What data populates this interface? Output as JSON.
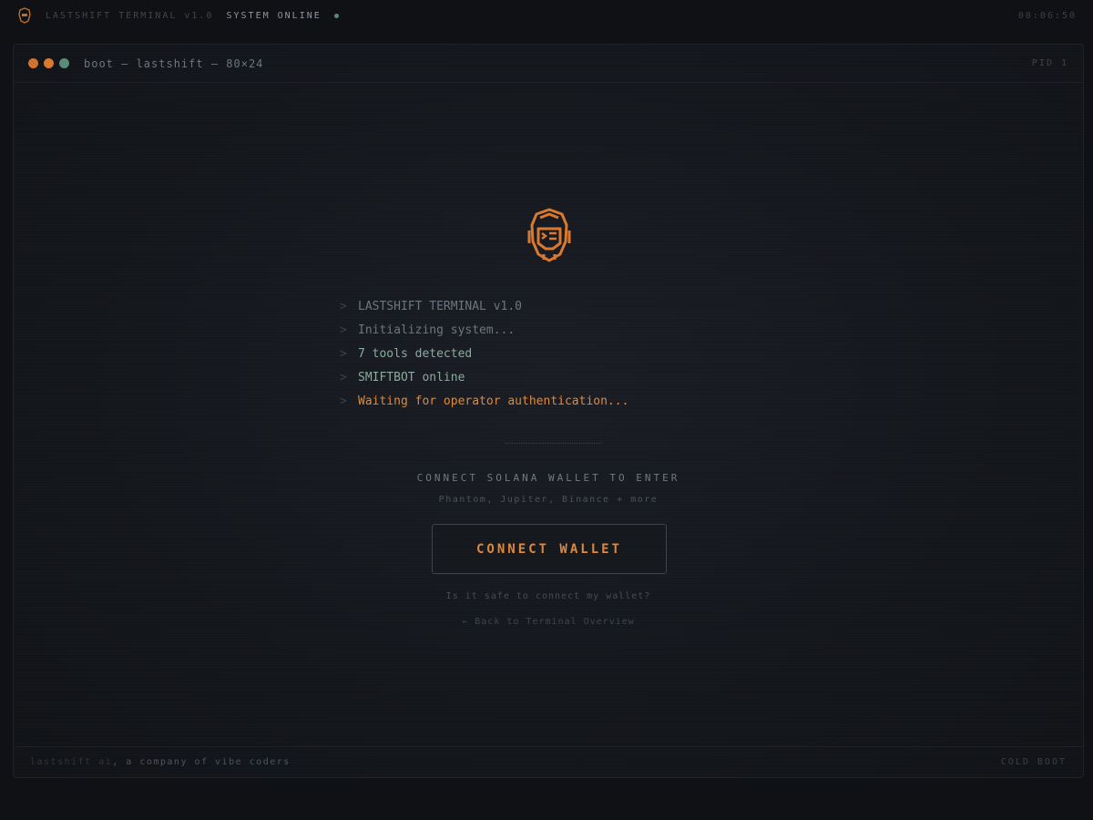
{
  "topbar": {
    "title": "LASTSHIFT TERMINAL v1.0",
    "status": "SYSTEM ONLINE",
    "clock": "00:06:50",
    "status_color": "#5a8a78"
  },
  "window": {
    "title": "boot — lastshift — 80×24",
    "pid": "PID 1",
    "lights": [
      "#d9782f",
      "#d9782f",
      "#5a8a78"
    ]
  },
  "log": {
    "prompt": ">",
    "lines": [
      {
        "text": "LASTSHIFT TERMINAL v1.0",
        "tone": "dim"
      },
      {
        "text": "Initializing system...",
        "tone": "dim"
      },
      {
        "text": "7 tools detected",
        "tone": "green"
      },
      {
        "text": "SMIFTBOT online",
        "tone": "green"
      },
      {
        "text": "Waiting for operator authentication...",
        "tone": "orange"
      }
    ]
  },
  "cta": {
    "title": "CONNECT SOLANA WALLET TO ENTER",
    "subtitle": "Phantom, Jupiter, Binance + more",
    "button_label": "CONNECT WALLET",
    "safe_link": "Is it safe to connect my wallet?",
    "back_link": "← Back to Terminal Overview"
  },
  "footer": {
    "brand": "lastshift ai",
    "tagline": ", a company of vibe coders",
    "mode": "COLD BOOT"
  },
  "colors": {
    "accent": "#e0883a",
    "green": "#8aab9d",
    "dim": "#6c7580"
  },
  "icons": {
    "logo": "robot-head-icon"
  }
}
